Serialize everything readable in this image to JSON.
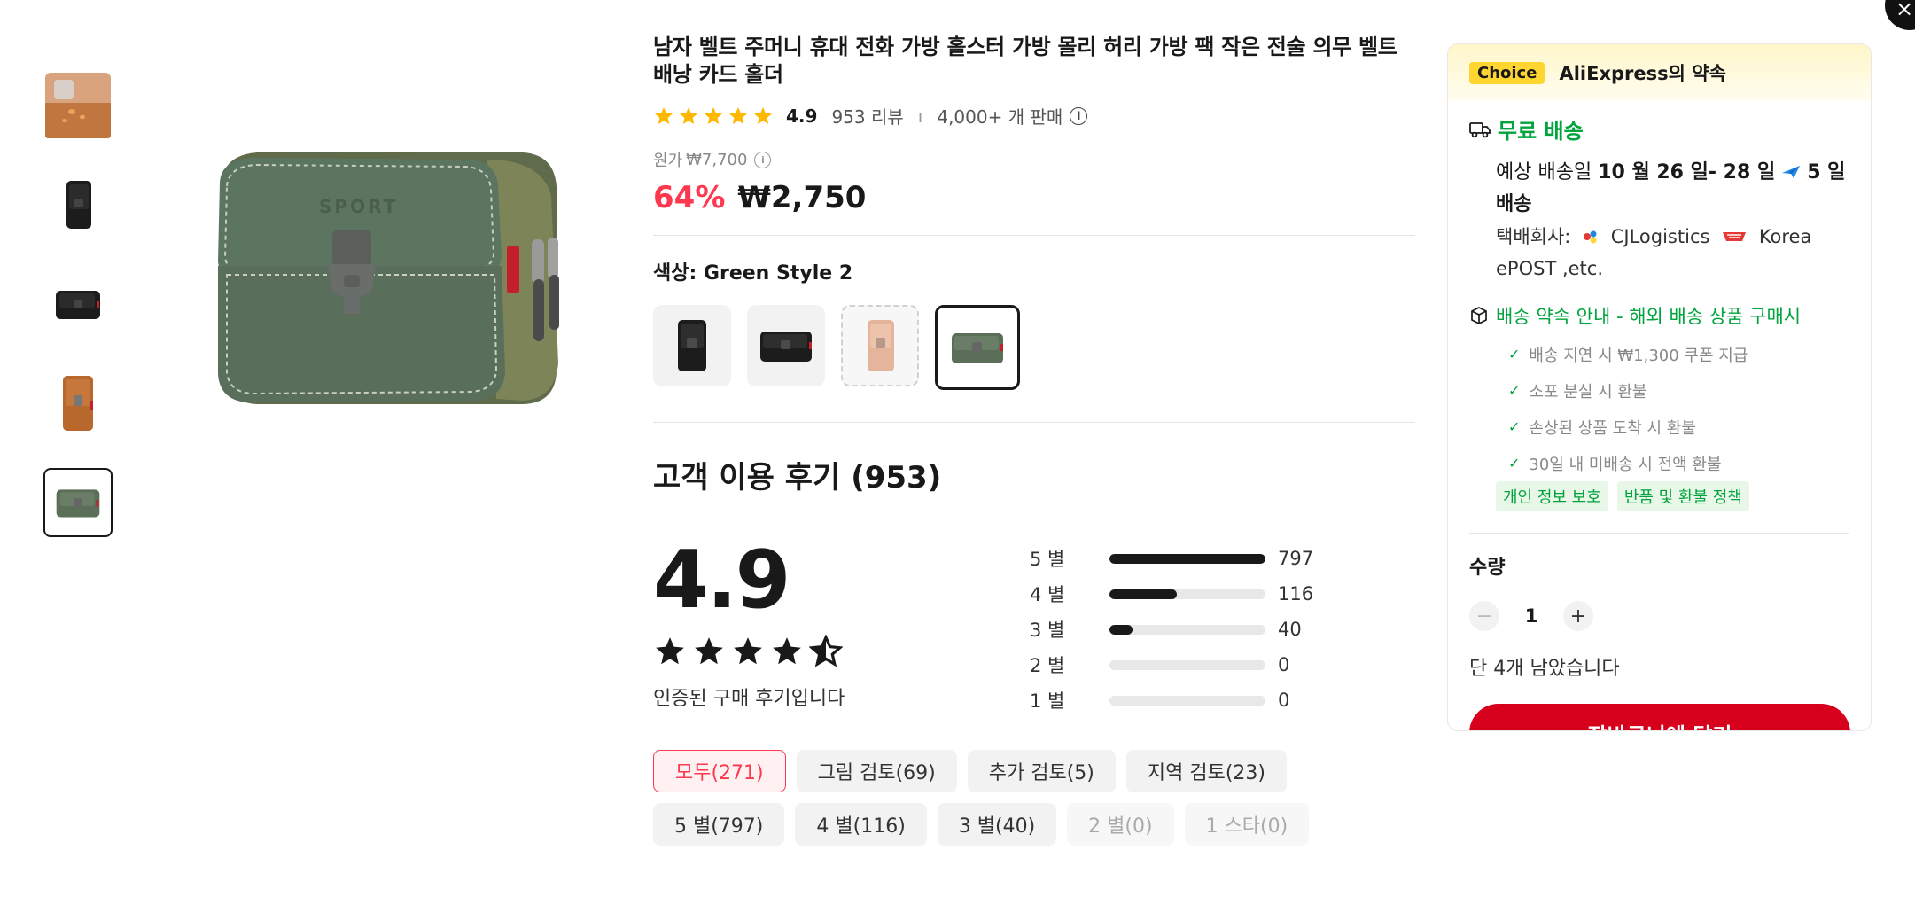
{
  "colors": {
    "accent_red": "#fd384f",
    "cart_red": "#d6001c",
    "green": "#00a33c",
    "choice_yellow": "#ffd52f",
    "star_gold": "#ffb800"
  },
  "product": {
    "title": "남자 벨트 주머니 휴대 전화 가방 홀스터 가방 몰리 허리 가방 팩 작은 전술 의무 벨트 배낭 카드 홀더",
    "rating": "4.9",
    "review_count": "953 리뷰",
    "sold": "4,000+ 개 판매",
    "original_price_label": "원가",
    "original_price": "₩7,700",
    "discount": "64%",
    "price": "₩2,750",
    "color_label": "색상: Green Style 2",
    "thumbnails": [
      "orange-brown pouch",
      "black pouch vertical",
      "black pouch horizontal",
      "brown pouch",
      "green pouch"
    ],
    "swatches": [
      "black vertical",
      "black horizontal",
      "pink",
      "green"
    ]
  },
  "reviews": {
    "title": "고객 이용 후기 (953)",
    "score": "4.9",
    "verified": "인증된 구매 후기입니다",
    "breakdown": [
      {
        "label": "5 별",
        "count": "797",
        "fraction": 1.0
      },
      {
        "label": "4 별",
        "count": "116",
        "fraction": 0.43
      },
      {
        "label": "3 별",
        "count": "40",
        "fraction": 0.15
      },
      {
        "label": "2 별",
        "count": "0",
        "fraction": 0
      },
      {
        "label": "1 별",
        "count": "0",
        "fraction": 0
      }
    ],
    "filters": [
      "모두(271)",
      "그림 검토(69)",
      "추가 검토(5)",
      "지역 검토(23)",
      "5 별(797)",
      "4 별(116)",
      "3 별(40)",
      "2 별(0)",
      "1 스타(0)"
    ]
  },
  "panel": {
    "choice_badge": "Choice",
    "promise": "AliExpress의 약속",
    "free_shipping": "무료 배송",
    "est_prefix": "예상 배송일",
    "est_dates": "10 월 26 일- 28 일",
    "est_days": "5 일 배송",
    "carrier_label": "택배회사:",
    "carrier_1": "CJLogistics",
    "carrier_2": "Korea ePOST ,etc.",
    "guarantee_title": "배송 약속 안내 - 해외 배송 상품 구매시",
    "guarantees": [
      "배송 지연 시 ₩1,300 쿠폰 지급",
      "소포 분실 시 환불",
      "손상된 상품 도착 시 환불",
      "30일 내 미배송 시 전액 환불"
    ],
    "tags": [
      "개인 정보 보호",
      "반품 및 환불 정책"
    ],
    "qty_label": "수량",
    "qty_value": "1",
    "qty_minus": "−",
    "qty_plus": "+",
    "stock": "단 4개 남았습니다",
    "cart_button": "장바구니에 담기"
  },
  "close_icon": "×"
}
